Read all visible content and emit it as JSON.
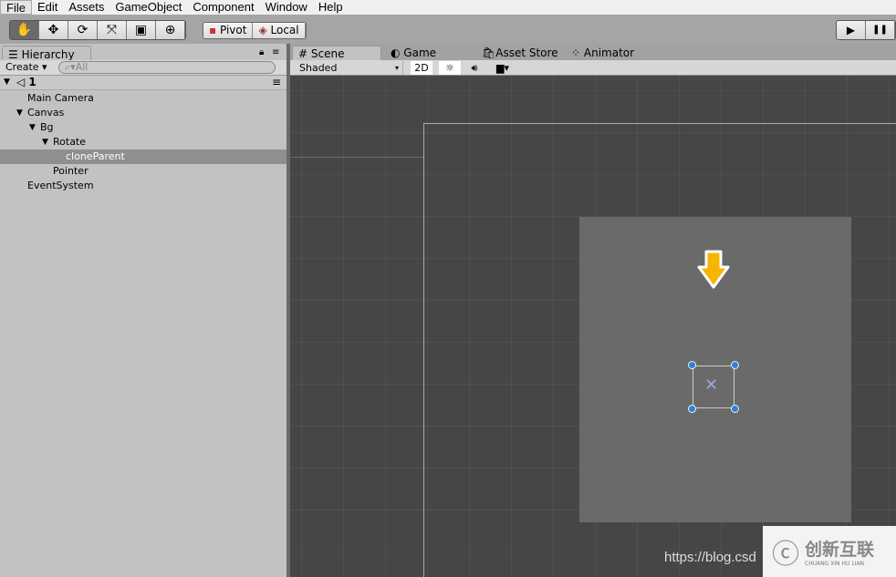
{
  "menu": [
    "File",
    "Edit",
    "Assets",
    "GameObject",
    "Component",
    "Window",
    "Help"
  ],
  "toolbar": {
    "tools": [
      "hand-icon",
      "move-icon",
      "rotate-icon",
      "scale-icon",
      "rect-icon",
      "transform-icon"
    ],
    "pivot": "Pivot",
    "local": "Local",
    "play": "▶",
    "pause": "❚❚"
  },
  "hierarchy": {
    "tab": "Hierarchy",
    "create": "Create",
    "search_placeholder": "All",
    "scene": "1",
    "items": [
      {
        "label": "Main Camera",
        "depth": 1
      },
      {
        "label": "Canvas",
        "depth": 1,
        "expanded": true
      },
      {
        "label": "Bg",
        "depth": 2,
        "expanded": true
      },
      {
        "label": "Rotate",
        "depth": 3,
        "expanded": true
      },
      {
        "label": "cloneParent",
        "depth": 4,
        "selected": true
      },
      {
        "label": "Pointer",
        "depth": 3
      },
      {
        "label": "EventSystem",
        "depth": 1
      }
    ]
  },
  "tabs": {
    "scene": "Scene",
    "game": "Game",
    "asset_store": "Asset Store",
    "animator": "Animator"
  },
  "scenebar": {
    "shading": "Shaded",
    "mode2d": "2D"
  },
  "watermark": {
    "url": "https://blog.csd",
    "logo": "创新互联",
    "logo_sub": "CHUANG XIN HU LIAN"
  },
  "colors": {
    "arrow": "#f7b500",
    "handle": "#3a7ad8"
  }
}
